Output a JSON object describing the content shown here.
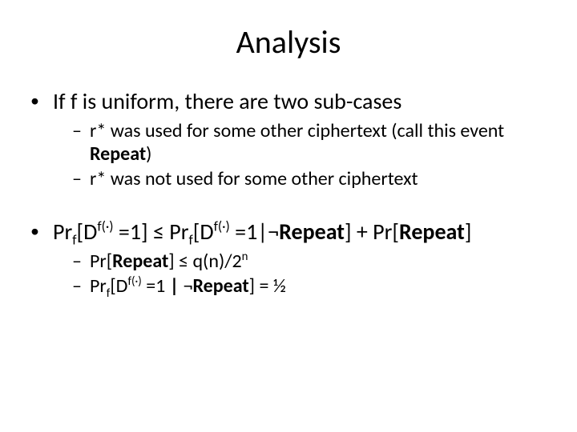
{
  "title": "Analysis",
  "bullet1": {
    "text": "If f is uniform, there are two sub-cases",
    "sub1_pre": "r* was used for some other ciphertext (call this event ",
    "sub1_bold": "Repeat",
    "sub1_post": ")",
    "sub2": "r* was not used for some other ciphertext"
  },
  "bullet2": {
    "p1": "Pr",
    "p2": "[D",
    "p3": " =1] ≤ Pr",
    "p4": "[D",
    "p5": " =1|¬",
    "p6": "Repeat",
    "p7": "] + Pr[",
    "p8": "Repeat",
    "p9": "]",
    "sup_f": "f(·)",
    "sub_f": "f",
    "sub1_a": "Pr[",
    "sub1_b": "Repeat",
    "sub1_c": "] ≤ q(n)/2",
    "sub1_d": "n",
    "sub2_a": "Pr",
    "sub2_b": "[D",
    "sub2_c": " =1 ",
    "sub2_d": "| ",
    "sub2_e": "¬",
    "sub2_f": "Repeat",
    "sub2_g": "] = ½"
  }
}
